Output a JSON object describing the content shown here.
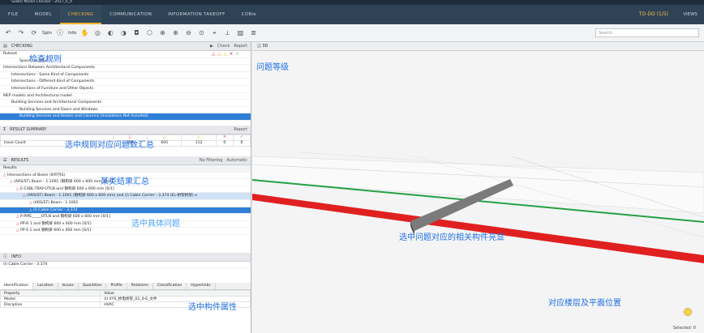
{
  "window": {
    "title": "Solibri Model Checker - 2017_6_A"
  },
  "menu": {
    "items": [
      "FILE",
      "MODEL",
      "CHECKING",
      "COMMUNICATION",
      "INFORMATION TAKEOFF",
      "COBie"
    ],
    "active_index": 2,
    "todo": "TO-DO (1/5)",
    "views": "VIEWS"
  },
  "toolbar": {
    "spin_label": "Spin",
    "info_label": "Info",
    "search_placeholder": "Search"
  },
  "checking": {
    "title": "CHECKING",
    "check_label": "Check",
    "report_label": "Report",
    "ruleset_label": "Ruleset",
    "rows": [
      {
        "label": "Space Location",
        "level": 2
      },
      {
        "label": "Intersections Between Architectural Components",
        "level": 0
      },
      {
        "label": "Intersections - Same Kind of Components",
        "level": 1
      },
      {
        "label": "Intersections - Different Kind of Components",
        "level": 1
      },
      {
        "label": "Intersections of Furniture and Other Objects",
        "level": 1
      },
      {
        "label": "MEP models and Architectural model",
        "level": 0
      },
      {
        "label": "Building Services and Architectural Components",
        "level": 1
      },
      {
        "label": "Building Services and Doors and Windows",
        "level": 2
      },
      {
        "label": "Building Services and Beams and Columns (Insulations Not Included)",
        "level": 2
      }
    ]
  },
  "summary": {
    "title": "RESULT SUMMARY",
    "report_label": "Report",
    "row_label": "Issue Count",
    "values": [
      "269",
      "605",
      "112",
      "0",
      "0"
    ]
  },
  "results": {
    "title": "RESULTS",
    "filter_label": "No Filtering",
    "auto_label": "Automatic",
    "header": "Results",
    "rows": [
      {
        "label": "Intersections of Beam (0/9791)",
        "level": 0
      },
      {
        "label": "(ARS/ST) Beam - 1.1001 (钢构梁 600 x 600 mm) [0/4]",
        "level": 1
      },
      {
        "label": "E-CABL-TRAY-OTLN and 钢构梁 600 x 600 mm [0/1]",
        "level": 2
      },
      {
        "label": "(ARS/ST) Beam - 1.1001 (钢构梁 600 x 600 mm) and (I) Cable Carrier - 3.374 (EL-桥架桥架) x",
        "level": 3
      },
      {
        "label": "(ARS/ST) Beam - 1.1001",
        "level": 4
      },
      {
        "label": "(I) Cable Carrier - 3.374",
        "level": 4
      },
      {
        "label": "P-PIPE_____OTLN and 钢构梁 600 x 600 mm [0/1]",
        "level": 2
      },
      {
        "label": "PP-R 1 and 钢构梁 600 x 600 mm [0/1]",
        "level": 2
      },
      {
        "label": "PP-S 1 and 钢构梁 600 x 600 mm [0/1]",
        "level": 2
      }
    ]
  },
  "info": {
    "title": "INFO",
    "subject": "(I) Cable Carrier - 3.374",
    "tabs": [
      "Identification",
      "Location",
      "Issues",
      "Quantities",
      "Profile",
      "Relations",
      "Classification",
      "Hyperlinks"
    ],
    "columns": [
      "Property",
      "Value"
    ],
    "rows": [
      {
        "property": "Model",
        "value": "(I) XYS_桥电桥架_02_0-6_文件"
      },
      {
        "property": "Discipline",
        "value": "HVAC"
      }
    ]
  },
  "view3d": {
    "title": "3D",
    "selected": "Selected: 0"
  },
  "annotations": {
    "check_rules": "检查规则",
    "issue_level": "问题等级",
    "summary_note": "选中规则对应问题数汇总",
    "results_note": "某类结果汇总",
    "selected_issue": "选中具体问题",
    "highlight_note": "选中问题对应的相关构件亮显",
    "props_note": "选中构件属性",
    "location_note": "对应楼层及平面位置"
  }
}
